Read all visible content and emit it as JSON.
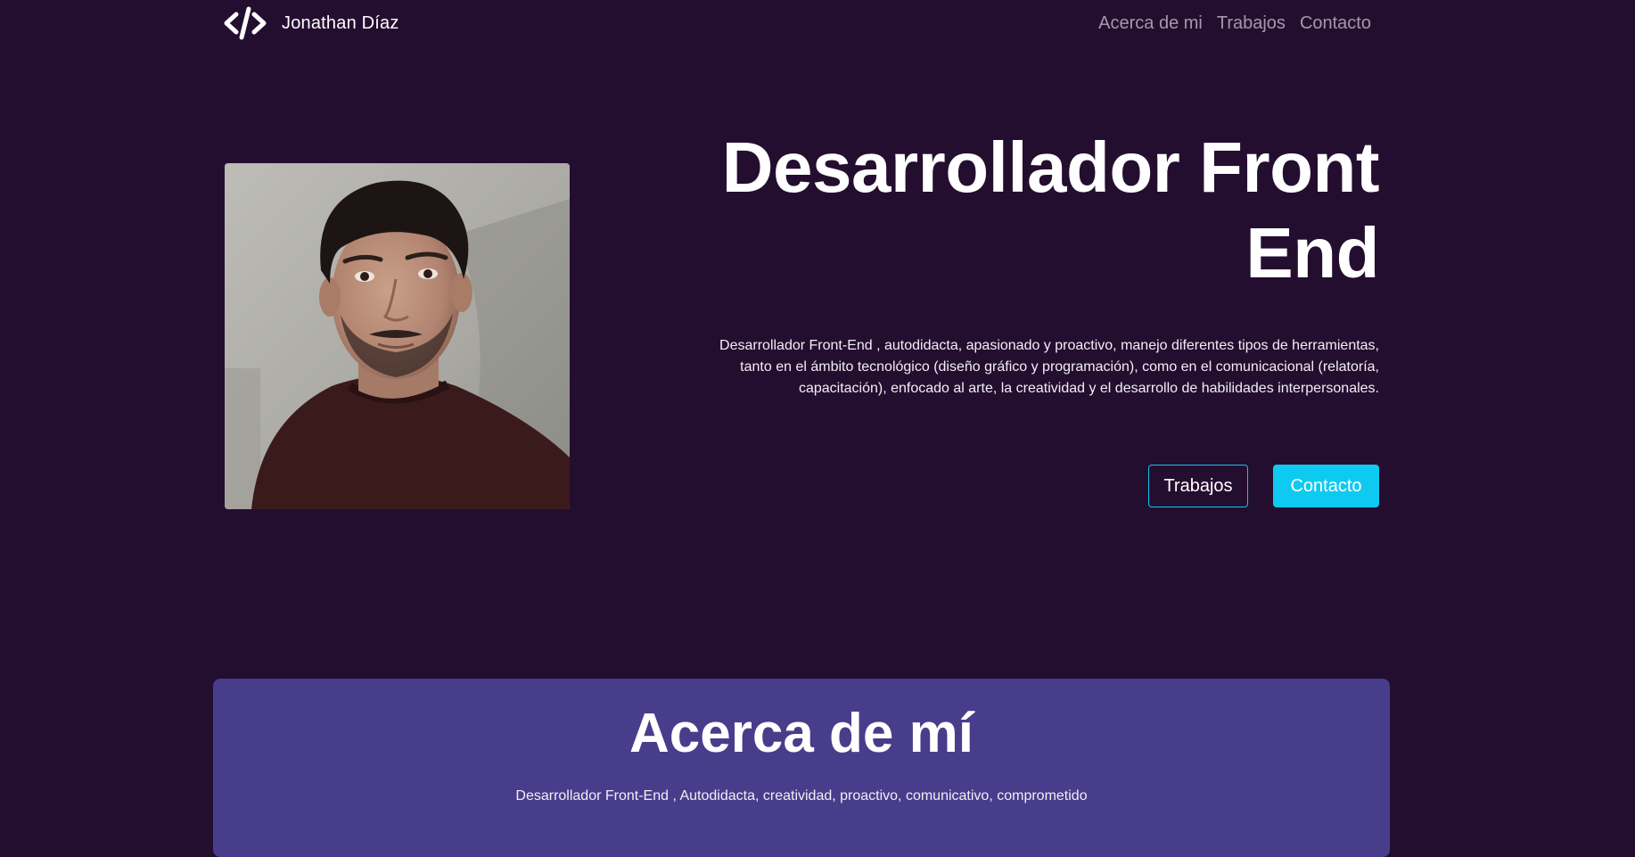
{
  "navbar": {
    "brand_name": "Jonathan Díaz",
    "logo_icon": "code-slash-icon",
    "links": [
      {
        "label": "Acerca de mi"
      },
      {
        "label": "Trabajos"
      },
      {
        "label": "Contacto"
      }
    ]
  },
  "hero": {
    "title_line1": "Desarrollador Front",
    "title_line2": "End",
    "description": "Desarrollador Front-End , autodidacta, apasionado y proactivo, manejo diferentes tipos de herramientas, tanto en el ámbito tecnológico (diseño gráfico y programación), como en el comunicacional (relatoría, capacitación), enfocado al arte, la creatividad y el desarrollo de habilidades interpersonales.",
    "buttons": {
      "works_label": "Trabajos",
      "contact_label": "Contacto"
    }
  },
  "about": {
    "title": "Acerca de mí",
    "text": "Desarrollador Front-End , Autodidacta, creatividad, proactivo, comunicativo, comprometido"
  },
  "colors": {
    "background": "#240e30",
    "about_card": "#483d8b",
    "accent": "#0fcaf0",
    "nav_link": "#a29aa9"
  }
}
